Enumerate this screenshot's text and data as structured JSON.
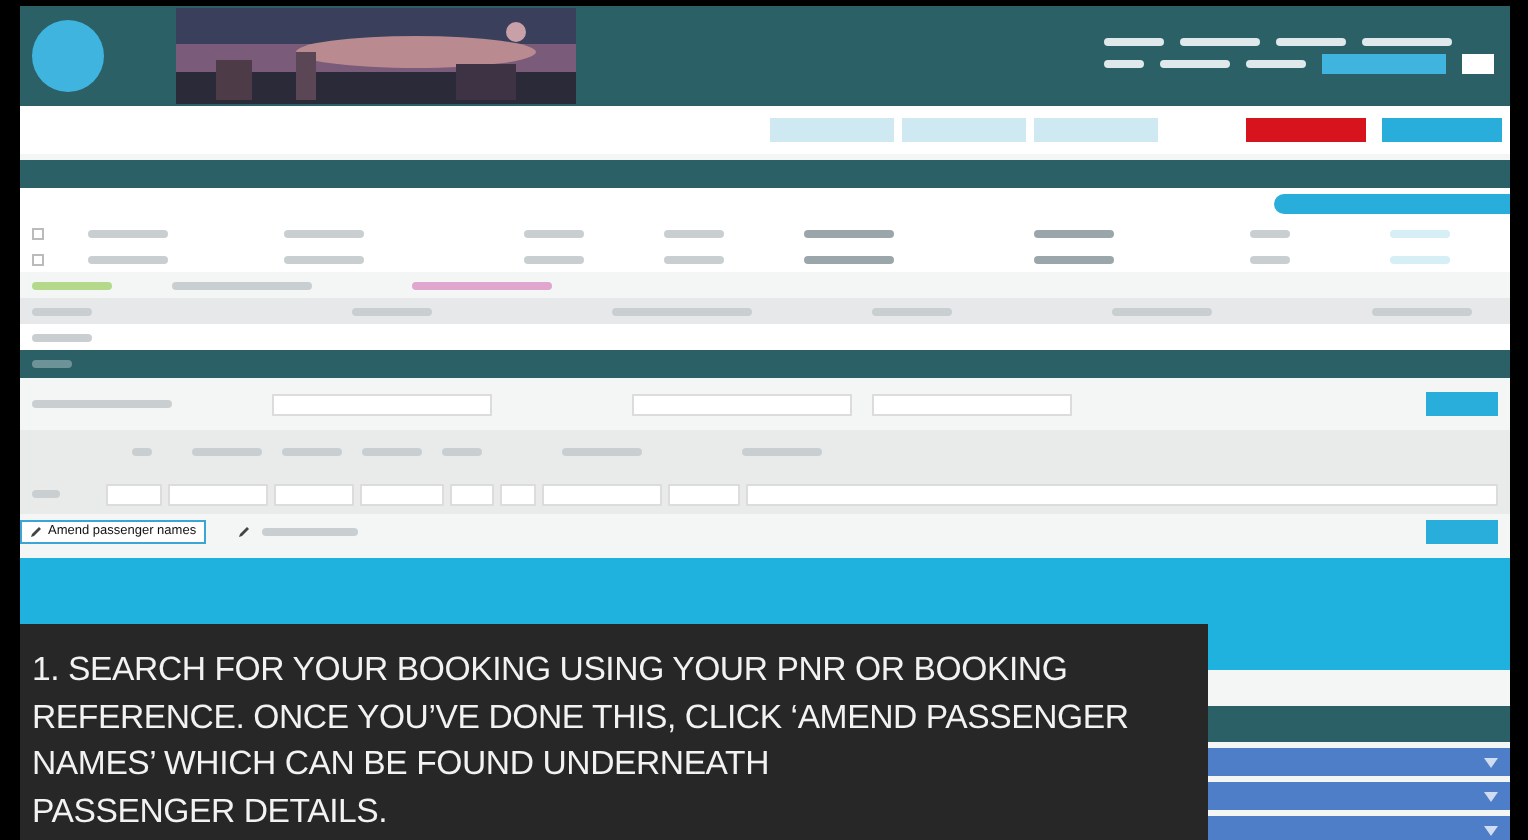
{
  "flight_rows": [
    {
      "checked": false
    },
    {
      "checked": false
    }
  ],
  "passenger_actions": [
    {
      "label": "Amend passenger names",
      "focused": true
    }
  ],
  "caption": {
    "lines": [
      "1. SEARCH FOR YOUR BOOKING USING YOUR PNR OR BOOKING",
      "REFERENCE. ONCE YOU’VE DONE THIS, CLICK ‘AMEND PASSENGER",
      "NAMES’  WHICH CAN BE FOUND UNDERNEATH",
      "PASSENGER DETAILS."
    ]
  }
}
